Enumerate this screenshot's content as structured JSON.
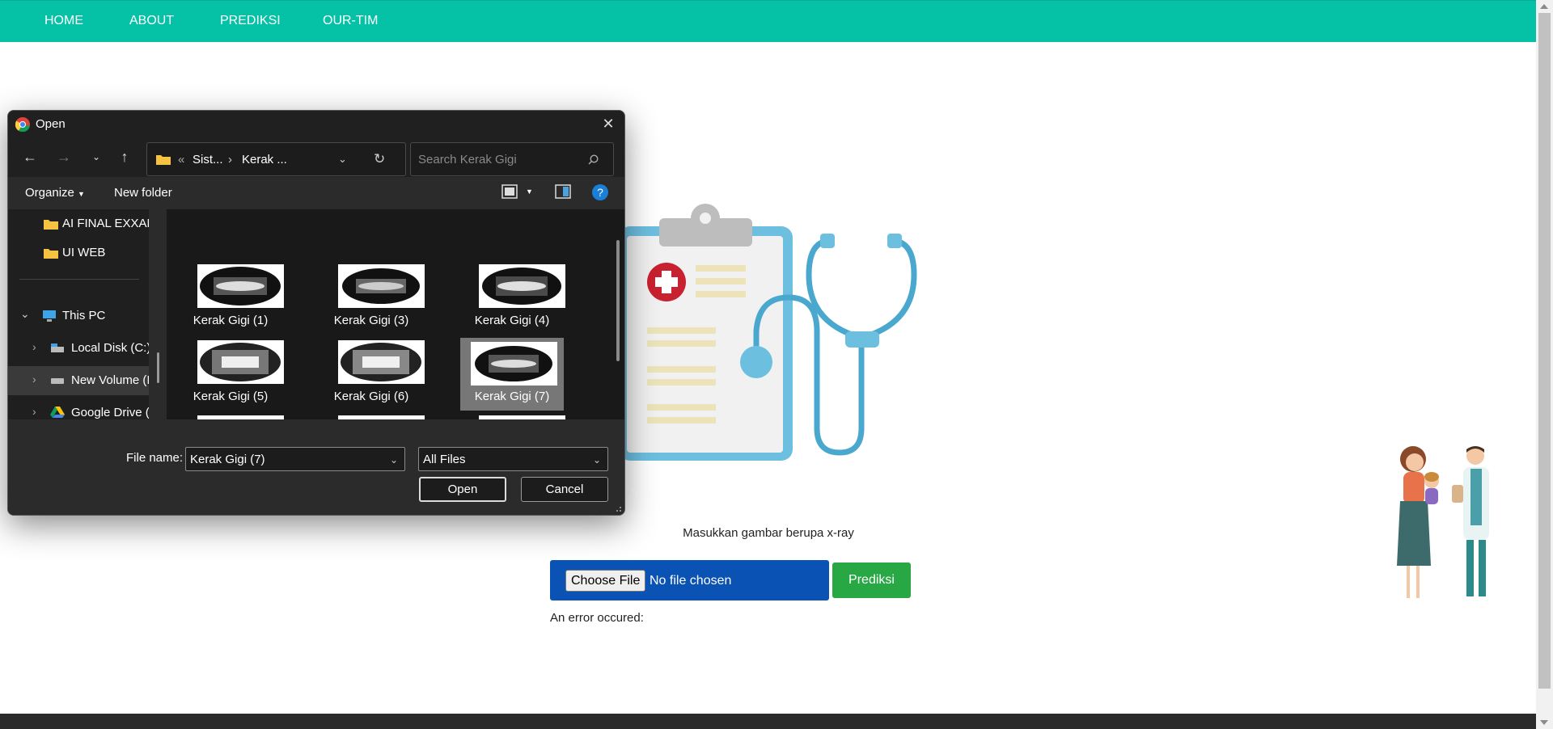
{
  "nav": {
    "items": [
      {
        "label": "HOME"
      },
      {
        "label": "ABOUT"
      },
      {
        "label": "PREDIKSI"
      },
      {
        "label": "OUR-TIM"
      }
    ],
    "background": "#05c1a6"
  },
  "main": {
    "instruction": "Masukkan gambar berupa x-ray",
    "file_input": {
      "button_label": "Choose File",
      "status": "No file chosen"
    },
    "predict_button": "Prediksi",
    "error_text": "An error occured:"
  },
  "dialog": {
    "title": "Open",
    "address": {
      "overflow": "«",
      "crumbs": [
        "Sist...",
        "Kerak ..."
      ]
    },
    "search_placeholder": "Search Kerak Gigi",
    "toolbar": {
      "organize": "Organize",
      "new_folder": "New folder"
    },
    "tree": [
      {
        "label": "AI FINAL EXXAM",
        "icon": "folder-icon"
      },
      {
        "label": "UI WEB",
        "icon": "folder-icon"
      },
      {
        "label": "This PC",
        "icon": "computer-icon"
      },
      {
        "label": "Local Disk (C:)",
        "icon": "drive-icon"
      },
      {
        "label": "New Volume (I",
        "icon": "drive-icon"
      },
      {
        "label": "Google Drive (",
        "icon": "google-drive-icon"
      }
    ],
    "files": [
      {
        "label": "Kerak Gigi (1)"
      },
      {
        "label": "Kerak Gigi (3)"
      },
      {
        "label": "Kerak Gigi (4)"
      },
      {
        "label": "Kerak Gigi (5)"
      },
      {
        "label": "Kerak Gigi (6)"
      },
      {
        "label": "Kerak Gigi (7)",
        "selected": true
      }
    ],
    "file_name_label": "File name:",
    "file_name_value": "Kerak Gigi (7)",
    "file_type": "All Files",
    "open_button": "Open",
    "cancel_button": "Cancel"
  },
  "colors": {
    "upload_box": "#0a52b3",
    "predict_button": "#28a745",
    "dialog_bg": "#2b2b2b"
  }
}
